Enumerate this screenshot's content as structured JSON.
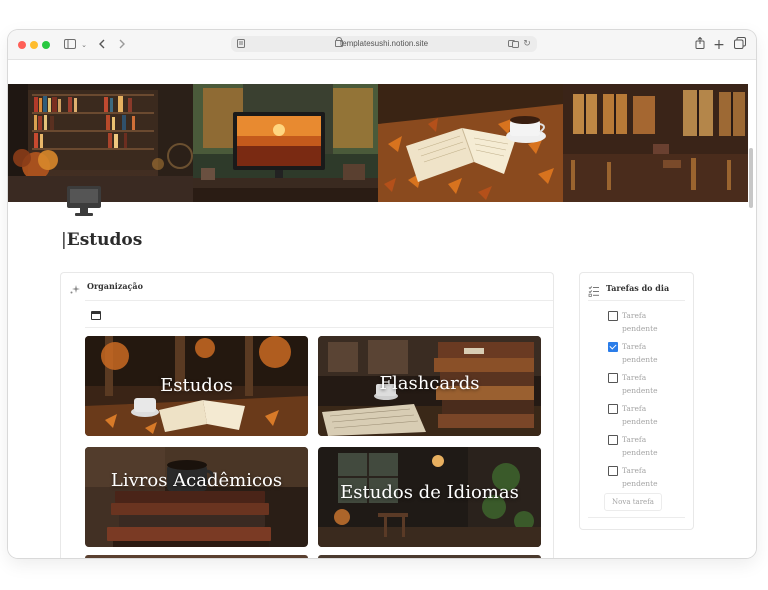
{
  "browser": {
    "url": "templatesushi.notion.site",
    "traffic_lights": {
      "close": "#ff5f57",
      "minimize": "#febc2e",
      "maximize": "#28c840"
    },
    "icons": [
      "sidebar-icon",
      "chevron-down-icon",
      "back-icon",
      "forward-icon",
      "reader-icon",
      "lock-icon",
      "translate-icon",
      "reload-icon",
      "share-icon",
      "new-tab-icon",
      "tabs-icon"
    ]
  },
  "page": {
    "title": "Estudos",
    "icon": "monitor-icon"
  },
  "organizacao": {
    "heading": "Organização",
    "icon": "sparkle-icon",
    "view_icon": "calendar-icon",
    "cards": [
      {
        "label": "Estudos"
      },
      {
        "label": "Flashcards"
      },
      {
        "label": "Livros Acadêmicos"
      },
      {
        "label": "Estudos de Idiomas"
      }
    ]
  },
  "tarefas": {
    "heading": "Tarefas do dia",
    "icon": "checklist-icon",
    "items": [
      {
        "label": "Tarefa pendente",
        "checked": false
      },
      {
        "label": "Tarefa pendente",
        "checked": true
      },
      {
        "label": "Tarefa pendente",
        "checked": false
      },
      {
        "label": "Tarefa pendente",
        "checked": false
      },
      {
        "label": "Tarefa pendente",
        "checked": false
      },
      {
        "label": "Tarefa pendente",
        "checked": false
      }
    ],
    "new_task": "Nova tarefa"
  },
  "colors": {
    "check_blue": "#2b7de9",
    "muted_text": "#a5a5a5",
    "title_text": "#2b2b2b"
  }
}
